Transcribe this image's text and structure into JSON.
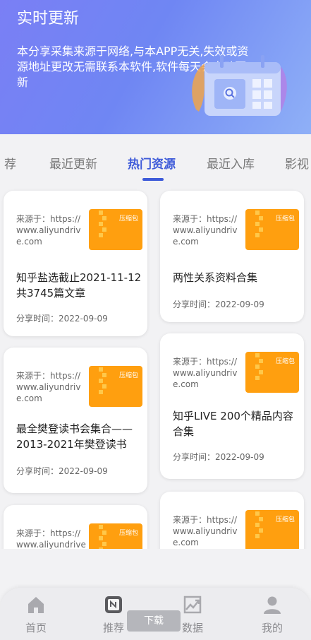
{
  "banner": {
    "title": "实时更新",
    "description": "本分享采集来源于网络,与本APP无关,失效或资源地址更改无需联系本软件,软件每天会自动更新"
  },
  "tabs": [
    {
      "label": "荐"
    },
    {
      "label": "最近更新"
    },
    {
      "label": "热门资源"
    },
    {
      "label": "最近入库"
    },
    {
      "label": "影视"
    }
  ],
  "active_tab": "热门资源",
  "cards": [
    {
      "source": "来源于：https://www.aliyundrive.com",
      "thumb_label": "压缩包",
      "title": "知乎盐选截止2021-11-12共3745篇文章",
      "time": "分享时间：2022-09-09"
    },
    {
      "source": "来源于：https://www.aliyundrive.com",
      "thumb_label": "压缩包",
      "title": "两性关系资料合集",
      "time": "分享时间：2022-09-09"
    },
    {
      "source": "来源于：https://www.aliyundrive.com",
      "thumb_label": "压缩包",
      "title": "最全樊登读书会集合——2013-2021年樊登读书会...",
      "time": "分享时间：2022-09-09"
    },
    {
      "source": "来源于：https://www.aliyundrive.com",
      "thumb_label": "压缩包",
      "title": "知乎LIVE 200个精品内容合集",
      "time": "分享时间：2022-09-09"
    },
    {
      "source": "来源于：https://www.aliyundrive",
      "thumb_label": "压缩包",
      "title": "",
      "time": ""
    },
    {
      "source": "来源于：https://www.aliyundrive.com",
      "thumb_label": "压缩包",
      "title": "",
      "time": ""
    }
  ],
  "bottom_nav": [
    {
      "label": "首页",
      "icon": "home-icon"
    },
    {
      "label": "推荐",
      "icon": "recommend-icon"
    },
    {
      "label": "数据",
      "icon": "chart-icon"
    },
    {
      "label": "我的",
      "icon": "user-icon"
    }
  ],
  "download_label": "下载",
  "colors": {
    "accent": "#3e5bd9",
    "thumb": "#ff9f0f",
    "banner_start": "#7a7ff5",
    "banner_end": "#8fb0f7"
  }
}
